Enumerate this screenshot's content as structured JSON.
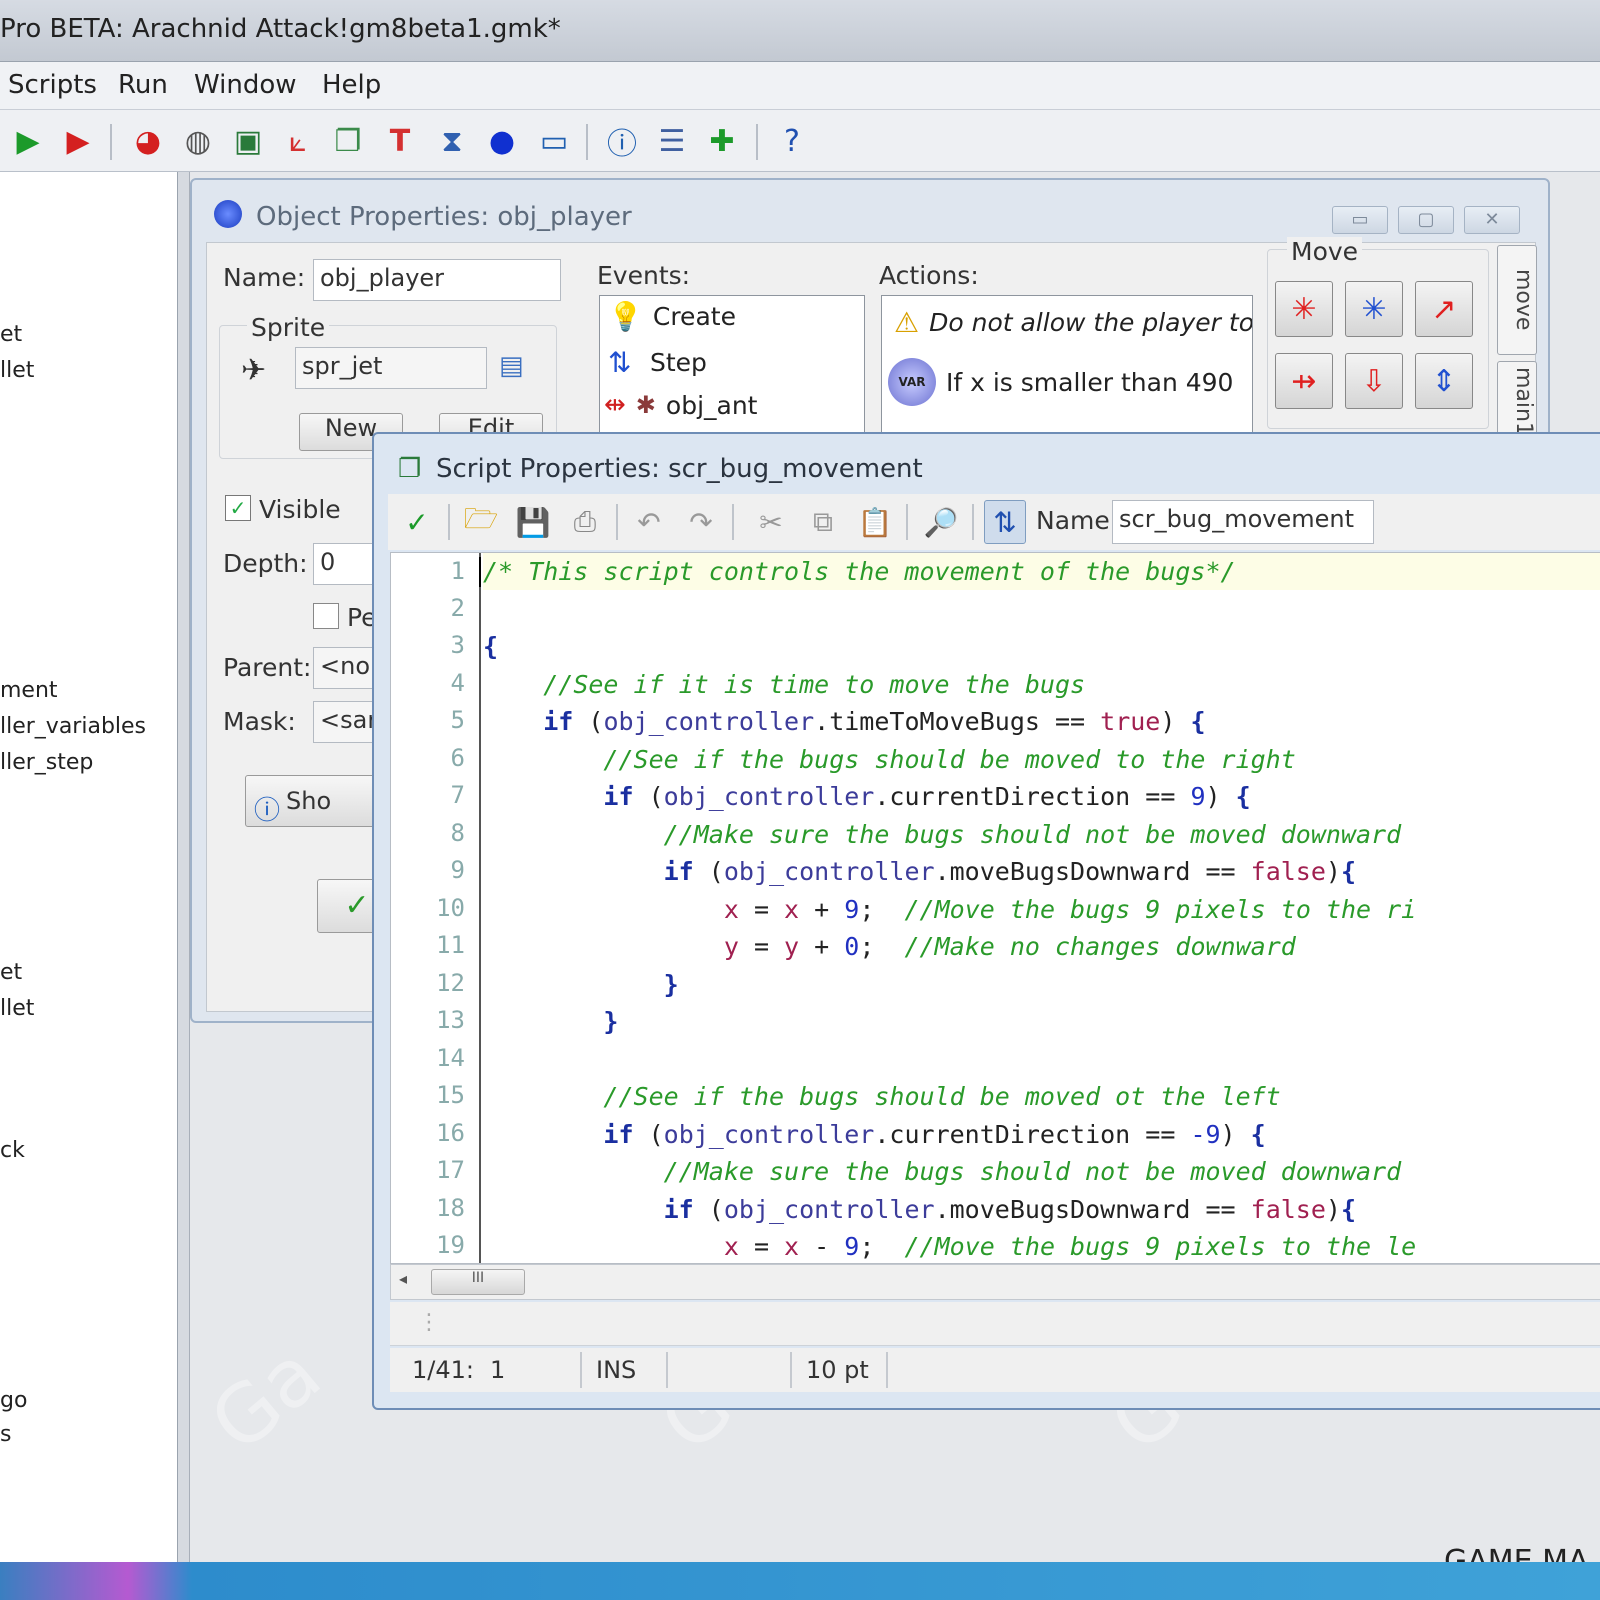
{
  "app": {
    "title": "Pro BETA: Arachnid Attack!gm8beta1.gmk*"
  },
  "menu": [
    "Scripts",
    "Run",
    "Window",
    "Help"
  ],
  "toolbar_icons": [
    "run-icon",
    "run-debug-icon",
    "sprite-icon",
    "sound-icon",
    "background-icon",
    "path-icon",
    "script-icon",
    "font-icon",
    "timeline-icon",
    "object-icon",
    "room-icon",
    "game-info-icon",
    "global-settings-icon",
    "extension-icon",
    "help-icon"
  ],
  "tree": {
    "items": [
      "et",
      "llet",
      "ment",
      "ller_variables",
      "ller_step",
      "et",
      "llet",
      "ck",
      "go",
      "s"
    ]
  },
  "object_window": {
    "title": "Object Properties: obj_player",
    "name_label": "Name:",
    "name_value": "obj_player",
    "sprite_group_label": "Sprite",
    "sprite_value": "spr_jet",
    "new_button": "New",
    "edit_button": "Edit",
    "visible_label": "Visible",
    "depth_label": "Depth:",
    "depth_value": "0",
    "persistent_label": "Pe",
    "parent_label": "Parent:",
    "parent_value": "<no",
    "mask_label": "Mask:",
    "mask_value": "<sam",
    "show_button": "Sho",
    "events_label": "Events:",
    "events": [
      "Create",
      "Step",
      "obj_ant"
    ],
    "actions_label": "Actions:",
    "actions": [
      "Do not allow the player to su",
      "If x is smaller than 490"
    ],
    "move_group_label": "Move",
    "side_tabs": [
      "move",
      "main1"
    ]
  },
  "script_window": {
    "title": "Script Properties: scr_bug_movement",
    "name_label": "Name:",
    "name_value": "scr_bug_movement",
    "line_numbers": [
      "1",
      "2",
      "3",
      "4",
      "5",
      "6",
      "7",
      "8",
      "9",
      "10",
      "11",
      "12",
      "13",
      "14",
      "15",
      "16",
      "17",
      "18",
      "19"
    ],
    "status": {
      "position": "1/41:",
      "column": "1",
      "mode": "INS",
      "font_size": "10 pt"
    }
  },
  "footer": {
    "brand": "GAME MA"
  },
  "colors": {
    "comment": "#2a9a2a",
    "keyword": "#1a2fa0",
    "variable": "#a02050",
    "number": "#2030c0"
  }
}
